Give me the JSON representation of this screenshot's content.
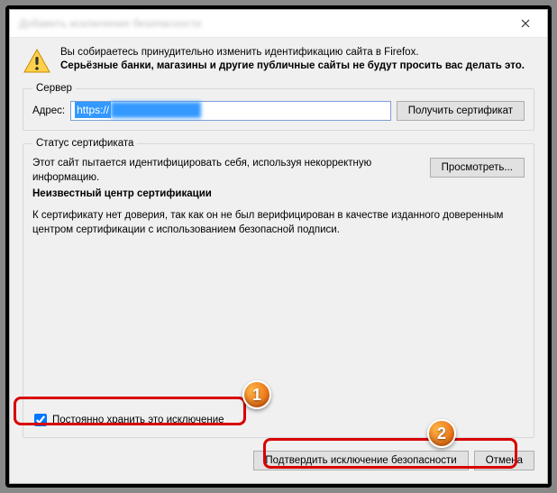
{
  "window": {
    "title": "Добавить исключение безопасности"
  },
  "warning": {
    "intro": "Вы собираетесь принудительно изменить идентификацию сайта в Firefox.",
    "bold": "Серьёзные банки, магазины и другие публичные сайты не будут просить вас делать это."
  },
  "server": {
    "legend": "Сервер",
    "address_label": "Адрес:",
    "address_value": "https://",
    "get_cert_button": "Получить сертификат"
  },
  "status": {
    "legend": "Статус сертификата",
    "line1": "Этот сайт пытается идентифицировать себя, используя некорректную информацию.",
    "view_button": "Просмотреть...",
    "unknown_ca": "Неизвестный центр сертификации",
    "trust_para": "К сертификату нет доверия, так как он не был верифицирован в качестве изданного доверенным центром сертификации с использованием безопасной подписи."
  },
  "checkbox": {
    "label": "Постоянно хранить это исключение",
    "checked": true
  },
  "buttons": {
    "confirm": "Подтвердить исключение безопасности",
    "cancel": "Отмена"
  },
  "annotations": {
    "badge1": "1",
    "badge2": "2"
  }
}
